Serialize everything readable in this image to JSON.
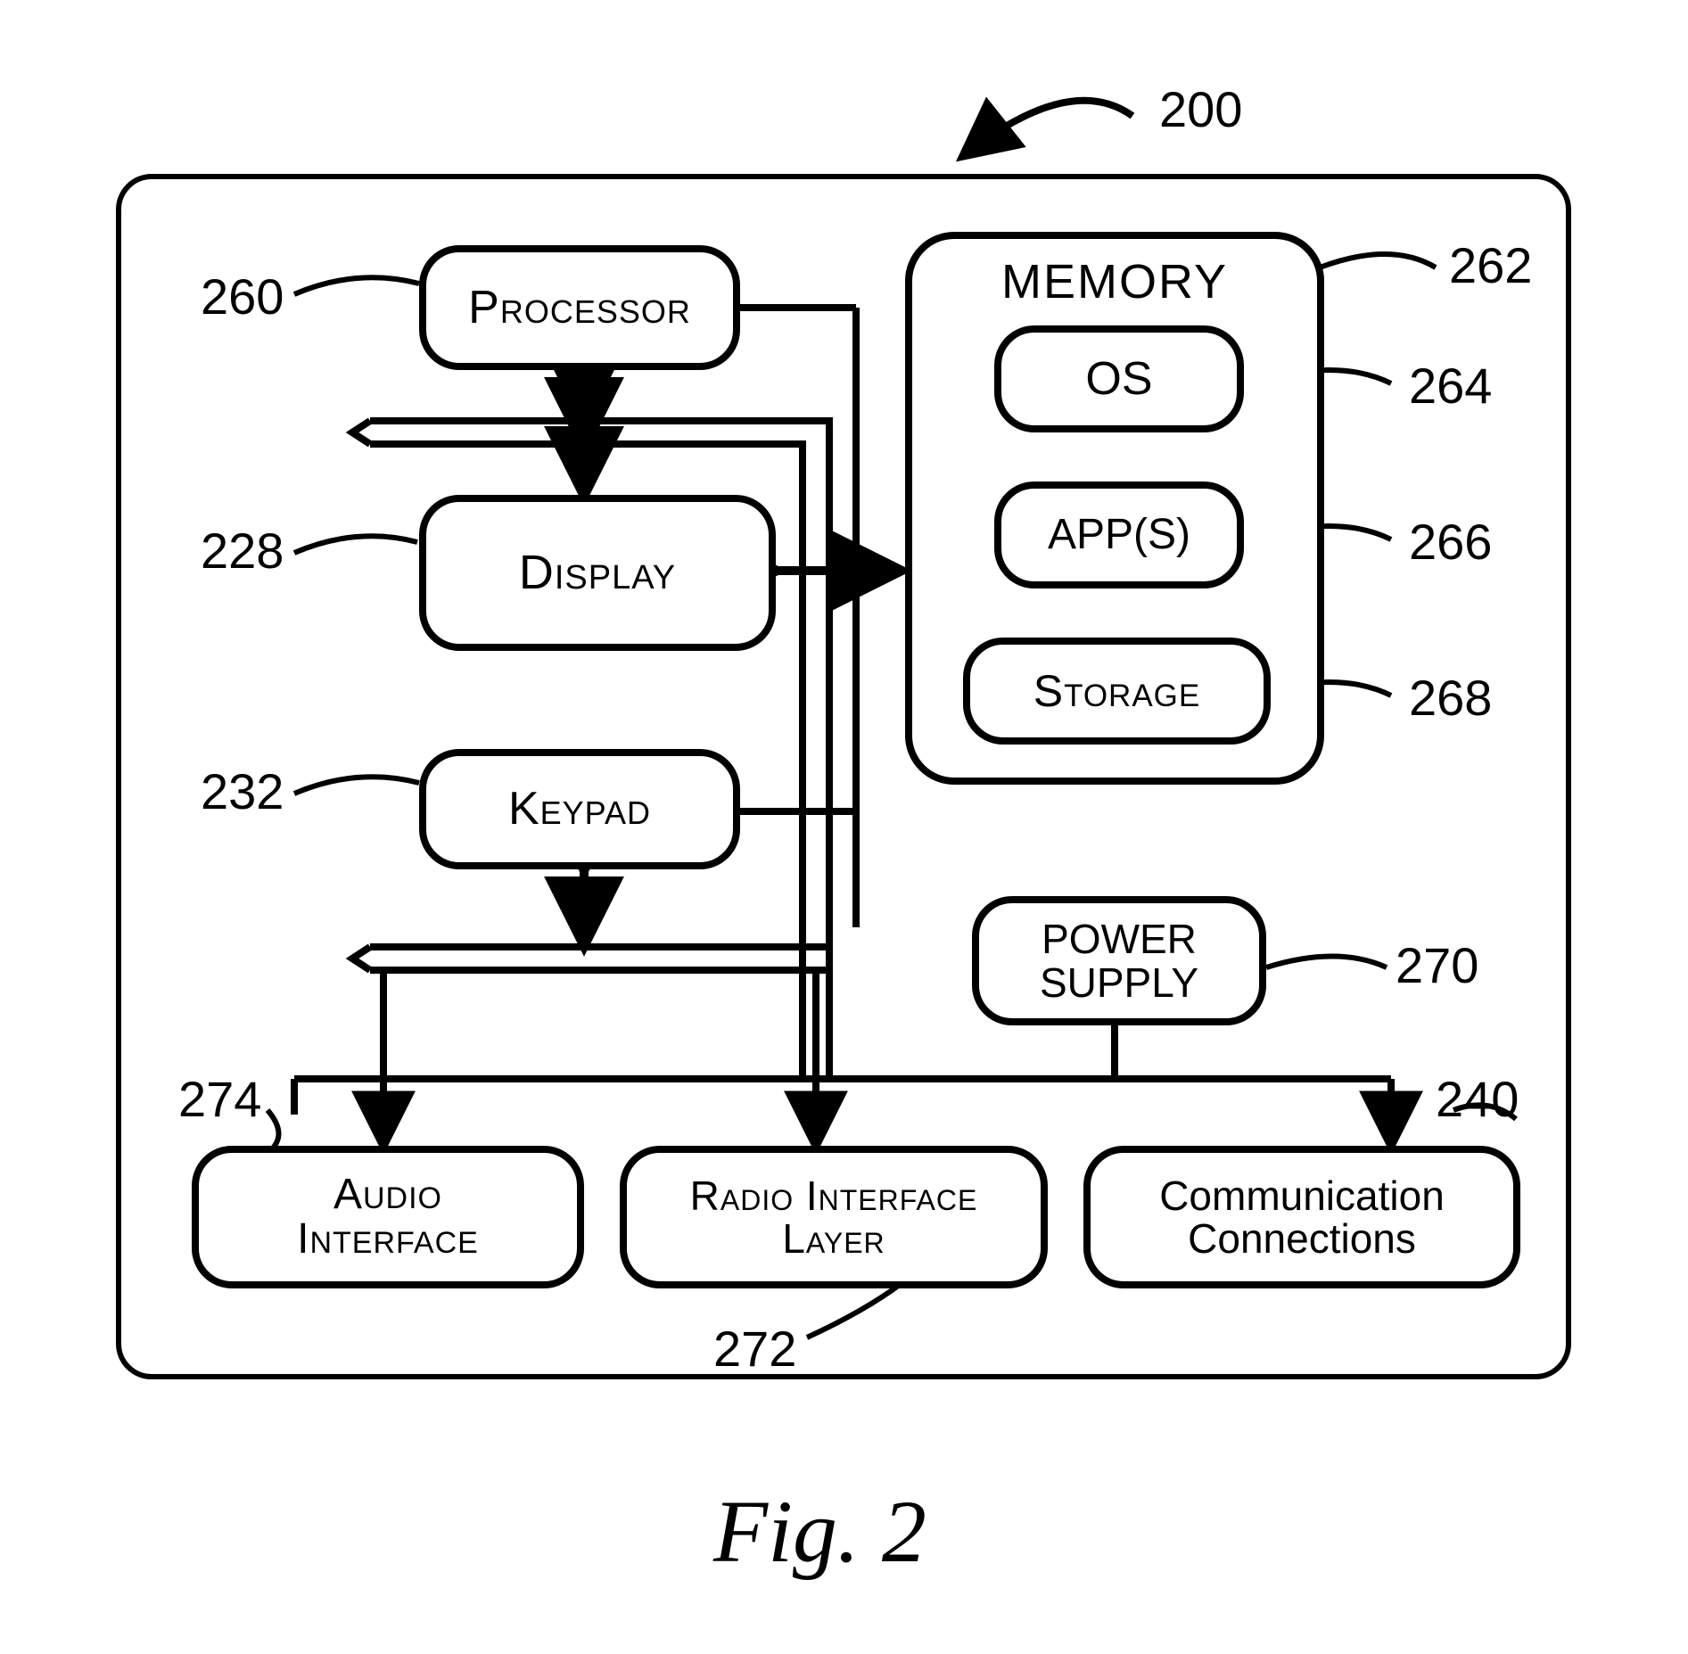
{
  "figure": {
    "caption": "Fig. 2"
  },
  "refs": {
    "device": "200",
    "processor": "260",
    "display": "228",
    "keypad": "232",
    "audio": "274",
    "ril": "272",
    "comm": "240",
    "power": "270",
    "memory": "262",
    "os": "264",
    "apps": "266",
    "storage": "268"
  },
  "blocks": {
    "processor": "Processor",
    "display": "Display",
    "keypad": "Keypad",
    "audio_l1": "Audio",
    "audio_l2": "Interface",
    "ril_l1": "Radio Interface",
    "ril_l2": "Layer",
    "comm_l1": "Communication",
    "comm_l2": "Connections",
    "power_l1": "POWER",
    "power_l2": "SUPPLY",
    "memory_title": "MEMORY",
    "os": "OS",
    "apps": "APP(S)",
    "storage": "Storage"
  }
}
